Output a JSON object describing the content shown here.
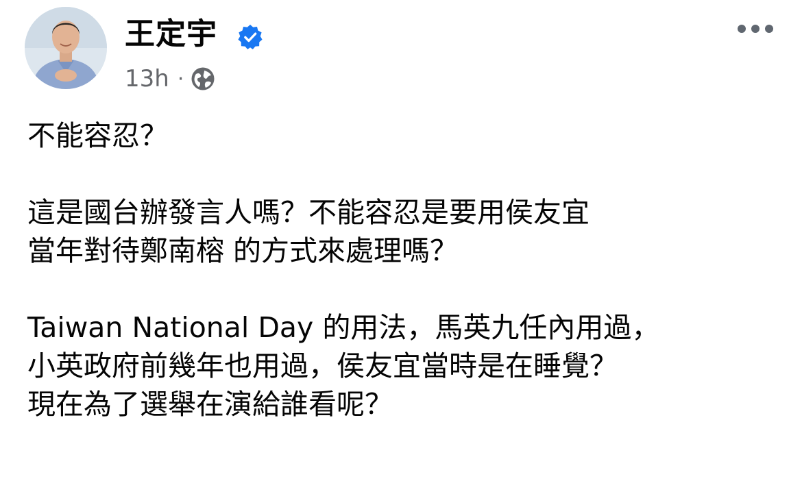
{
  "post": {
    "author": {
      "name": "王定宇",
      "verified": true,
      "avatar_icon": "profile-photo"
    },
    "meta": {
      "timestamp": "13h",
      "separator": "·",
      "audience_icon": "globe-icon"
    },
    "menu_icon": "more-dots-icon",
    "paragraphs": [
      {
        "lines": [
          "不能容忍？"
        ]
      },
      {
        "lines": [
          "這是國台辦發言人嗎？不能容忍是要用侯友宜",
          "當年對待鄭南榕 的方式來處理嗎？"
        ]
      },
      {
        "lines": [
          "Taiwan National Day 的用法，馬英九任內用過，",
          "小英政府前幾年也用過，侯友宜當時是在睡覺？",
          "現在為了選舉在演給誰看呢？"
        ]
      }
    ]
  },
  "colors": {
    "text": "#050505",
    "secondary_text": "#65676b",
    "verified_blue": "#1877f2",
    "background": "#ffffff"
  }
}
